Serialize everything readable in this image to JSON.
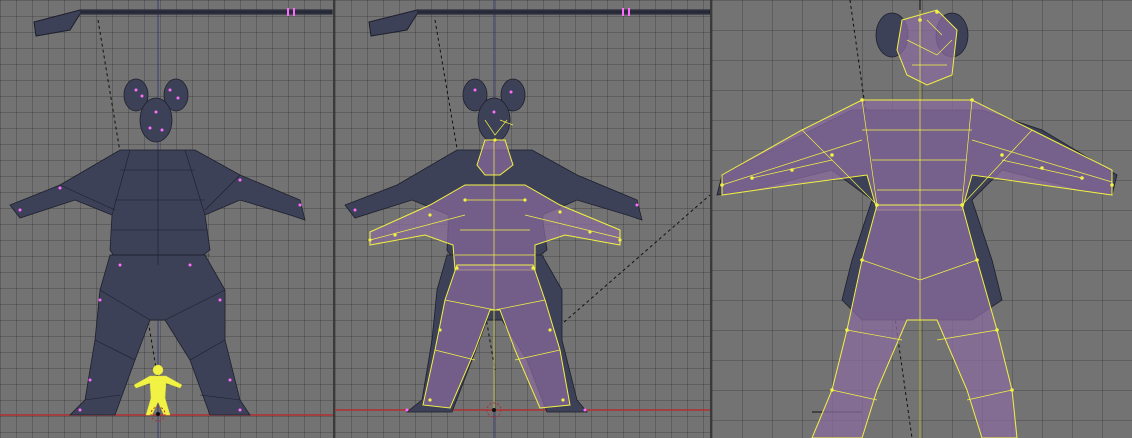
{
  "app": {
    "kind": "3d-viewport-comparison",
    "panes": 3
  },
  "viewports": [
    {
      "id": "left",
      "label": ""
    },
    {
      "id": "middle",
      "label": ""
    },
    {
      "id": "right",
      "label": ""
    }
  ],
  "colors": {
    "grid_bg": "#737373",
    "grid_line": "#5e5e5e",
    "mesh_fill": "#3d4157",
    "mesh_wire": "#1d1f2c",
    "vertex": "#ff6cff",
    "selected_wire": "#f2f244",
    "selected_fill": "#8a6b9e",
    "axis_x": "#b03030",
    "axis_y": "#3b3b7a",
    "dotted_line": "#111111"
  },
  "icons": {
    "camera": "camera-icon",
    "pivot": "pivot-cursor-icon"
  }
}
